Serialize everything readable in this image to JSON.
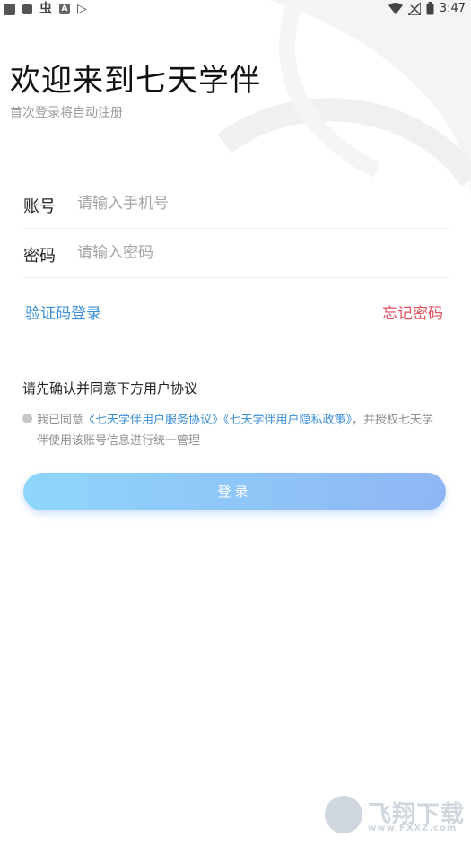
{
  "status_bar": {
    "left_icons": [
      "square-icon",
      "square-icon",
      "bug-icon",
      "a-icon",
      "play-icon"
    ],
    "right_icons": [
      "wifi-icon",
      "signal-off-icon",
      "battery-icon"
    ],
    "time": "3:47"
  },
  "header": {
    "title": "欢迎来到七天学伴",
    "subtitle": "首次登录将自动注册"
  },
  "form": {
    "phone_label": "账号",
    "phone_placeholder": "请输入手机号",
    "password_label": "密码",
    "password_placeholder": "请输入密码"
  },
  "links": {
    "code_login": "验证码登录",
    "forgot_password": "忘记密码"
  },
  "agreement": {
    "notice": "请先确认并同意下方用户协议",
    "prefix": "我已同意",
    "service_policy": "《七天学伴用户服务协议》",
    "privacy_policy": "《七天学伴用户隐私政策》",
    "suffix": "，并授权七天学伴使用该账号信息进行统一管理"
  },
  "login_button": "登录",
  "watermark": {
    "text": "飞翔下载",
    "url": "www.FXXZ.com"
  },
  "colors": {
    "link_blue": "#3a8fd9",
    "forgot_red": "#e2505e",
    "button_start": "#8fd6fb",
    "button_end": "#8fb6f4"
  }
}
